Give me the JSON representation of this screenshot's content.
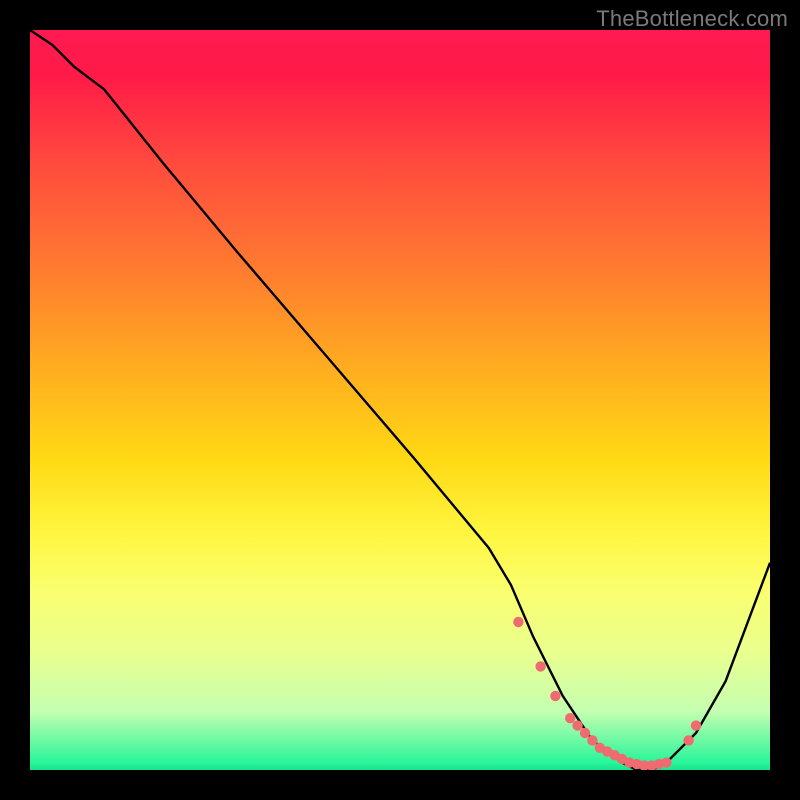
{
  "watermark": "TheBottleneck.com",
  "chart_data": {
    "type": "line",
    "title": "",
    "xlabel": "",
    "ylabel": "",
    "xlim": [
      0,
      100
    ],
    "ylim": [
      0,
      100
    ],
    "grid": false,
    "legend": false,
    "notes": "Background is a vertical mismatch heatmap (red=high, green=low). The black curve is the mismatch vs the x-axis variable; the valley with red dotted markers indicates the optimal/near-zero-bottleneck region.",
    "series": [
      {
        "name": "mismatch-curve",
        "color": "#000000",
        "x": [
          0,
          3,
          6,
          10,
          18,
          28,
          40,
          52,
          62,
          65,
          68,
          72,
          76,
          80,
          82,
          84,
          86,
          90,
          94,
          100
        ],
        "y": [
          100,
          98,
          95,
          92,
          82,
          70,
          56,
          42,
          30,
          25,
          18,
          10,
          4,
          1,
          0,
          0,
          1,
          5,
          12,
          28
        ]
      },
      {
        "name": "optimal-zone-markers",
        "color": "#ef6b6f",
        "marker": "dot",
        "x": [
          66,
          69,
          71,
          73,
          74,
          75,
          76,
          77,
          78,
          79,
          80,
          81,
          82,
          83,
          84,
          85,
          86,
          89,
          90
        ],
        "y": [
          20,
          14,
          10,
          7,
          6,
          5,
          4,
          3,
          2.5,
          2,
          1.5,
          1,
          0.8,
          0.6,
          0.6,
          0.8,
          1,
          4,
          6
        ]
      }
    ]
  }
}
